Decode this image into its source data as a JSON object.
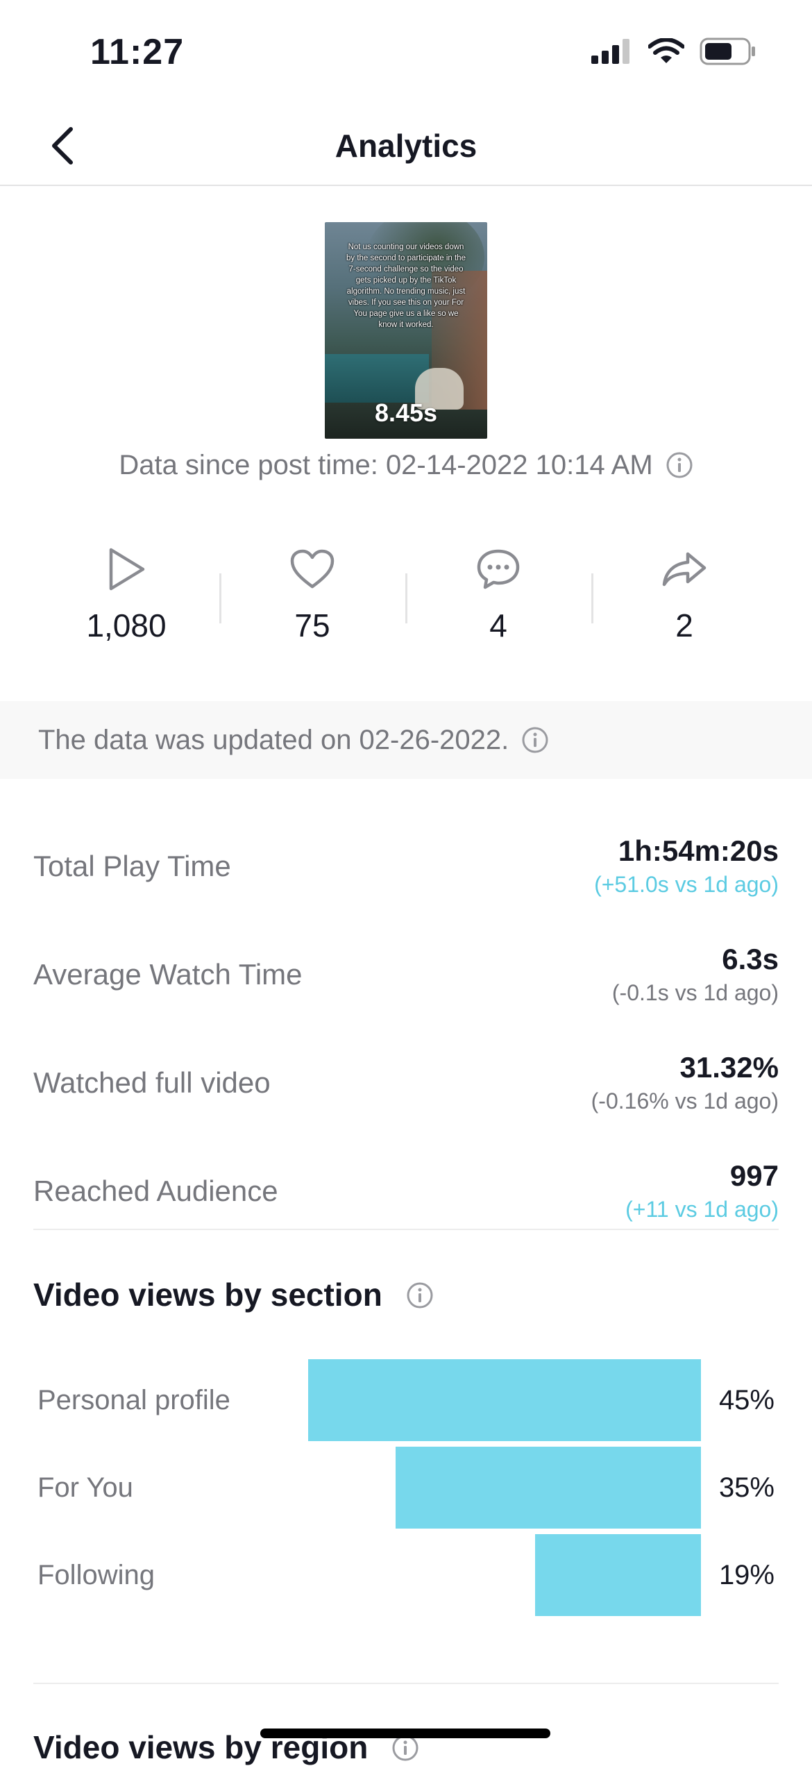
{
  "status_bar": {
    "time": "11:27",
    "signal_icon": "cellular-signal-icon",
    "wifi_icon": "wifi-icon",
    "battery_icon": "battery-icon"
  },
  "nav": {
    "title": "Analytics",
    "back_icon": "chevron-left-icon"
  },
  "video": {
    "caption": "Not us counting our videos down by the second to participate in the 7-second challenge so the video gets picked up by the TikTok algorithm. No trending music, just vibes. If you see this on your For You page give us a like so we know it worked.",
    "duration": "8.45s",
    "post_time_label": "Data since post time: 02-14-2022 10:14 AM"
  },
  "stats": [
    {
      "icon": "play-icon",
      "value": "1,080"
    },
    {
      "icon": "heart-icon",
      "value": "75"
    },
    {
      "icon": "comment-icon",
      "value": "4"
    },
    {
      "icon": "share-icon",
      "value": "2"
    }
  ],
  "updated_notice": "The data was updated on 02-26-2022.",
  "metrics": [
    {
      "label": "Total Play Time",
      "value": "1h:54m:20s",
      "delta": "(+51.0s vs 1d ago)",
      "trend": "up"
    },
    {
      "label": "Average Watch Time",
      "value": "6.3s",
      "delta": "(-0.1s vs 1d ago)",
      "trend": "down"
    },
    {
      "label": "Watched full video",
      "value": "31.32%",
      "delta": "(-0.16% vs 1d ago)",
      "trend": "down"
    },
    {
      "label": "Reached Audience",
      "value": "997",
      "delta": "(+11 vs 1d ago)",
      "trend": "up"
    }
  ],
  "views_by_section": {
    "title": "Video views by section",
    "bar_color": "#77d8ec"
  },
  "chart_data": {
    "type": "bar",
    "categories": [
      "Personal profile",
      "For You",
      "Following"
    ],
    "values": [
      45,
      35,
      19
    ],
    "value_labels": [
      "45%",
      "35%",
      "19%"
    ]
  },
  "views_by_region": {
    "title": "Video views by region"
  },
  "colors": {
    "accent_positive": "#5bcbe2",
    "muted_text": "#75767c",
    "primary_text": "#161823"
  }
}
